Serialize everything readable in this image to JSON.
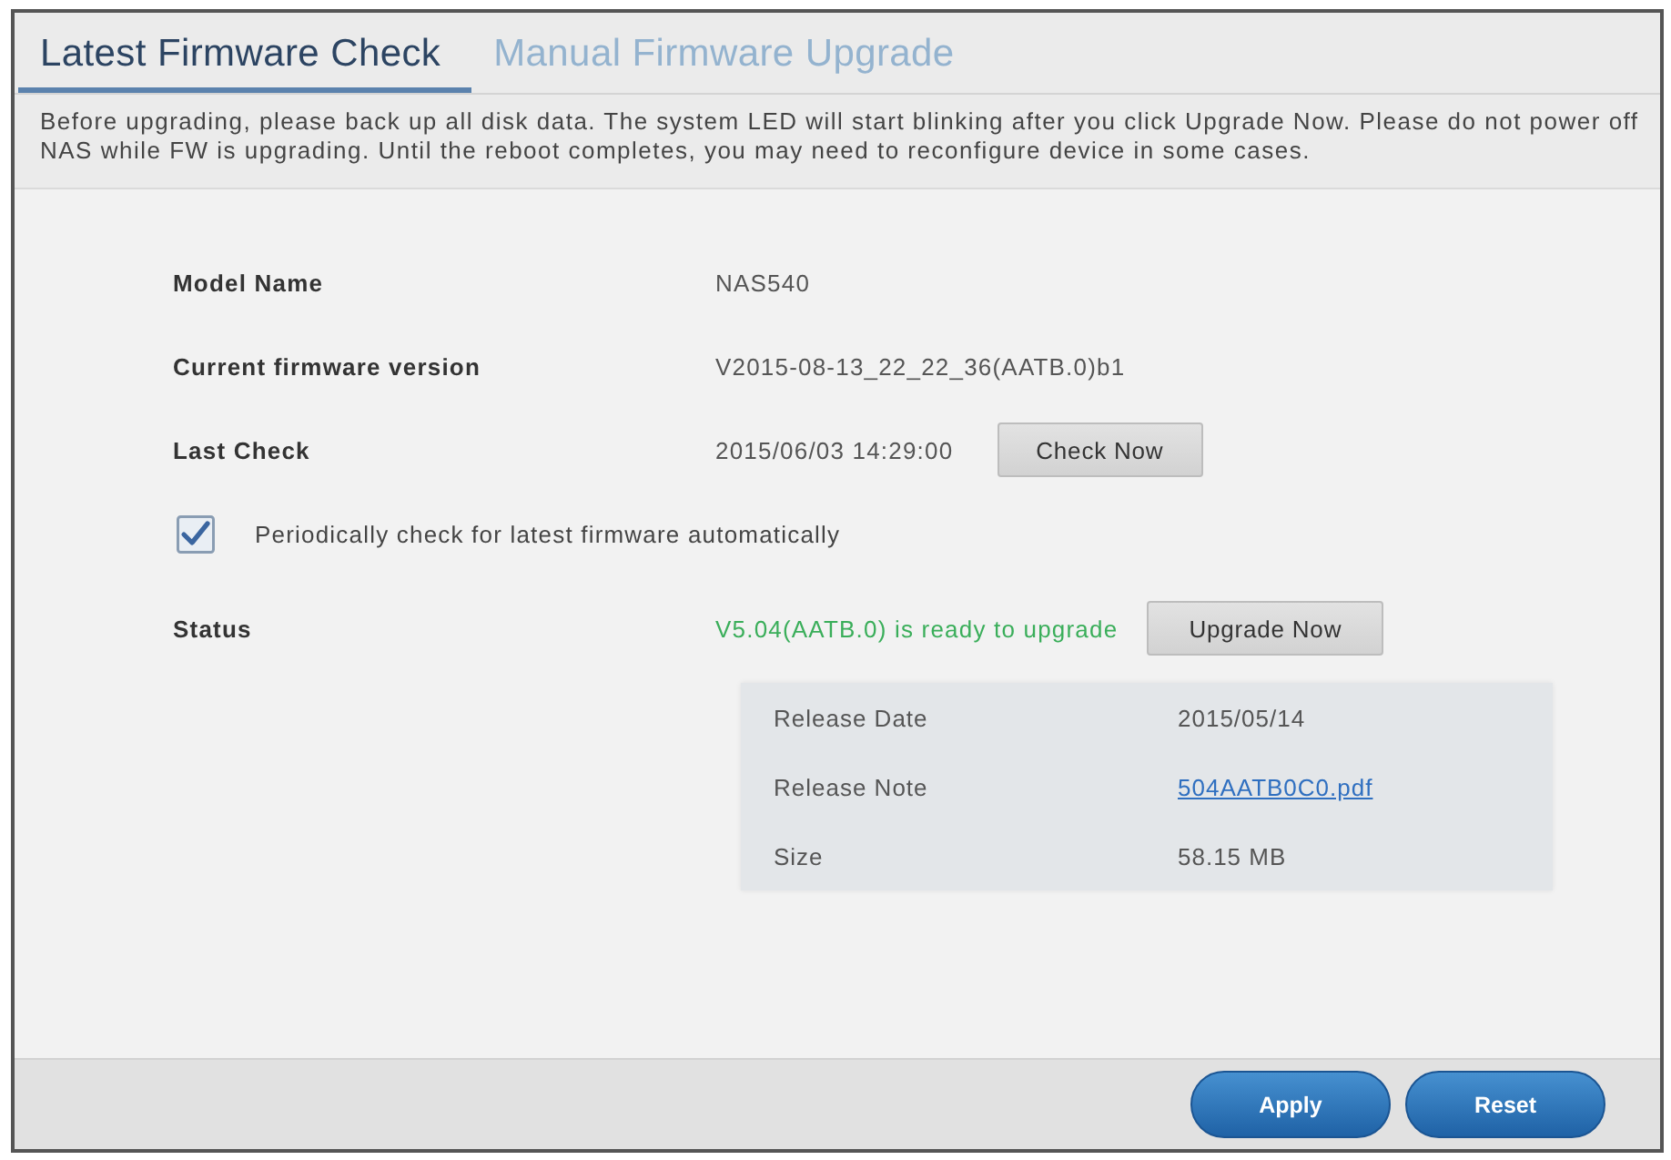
{
  "tabs": [
    {
      "label": "Latest Firmware Check",
      "selected": true
    },
    {
      "label": "Manual Firmware Upgrade",
      "selected": false
    }
  ],
  "notice": "Before upgrading, please back up all disk data. The system LED will start blinking after you click Upgrade Now. Please do not power off NAS while FW is upgrading. Until the reboot completes, you may need to reconfigure device in some cases.",
  "info_rows": [
    {
      "label": "Model Name",
      "value": "NAS540"
    },
    {
      "label": "Current firmware version",
      "value": "V2015-08-13_22_22_36(AATB.0)b1"
    },
    {
      "label": "Last Check",
      "value": "2015/06/03 14:29:00",
      "button": "Check Now"
    }
  ],
  "auto_check": {
    "label": "Periodically check for latest firmware automatically",
    "checked": true
  },
  "status": {
    "label": "Status",
    "value": "V5.04(AATB.0) is ready to upgrade",
    "button": "Upgrade Now"
  },
  "release_info": [
    {
      "label": "Release Date",
      "value": "2015/05/14",
      "kind": "text"
    },
    {
      "label": "Release Note",
      "value": "504AATB0C0.pdf",
      "kind": "link"
    },
    {
      "label": "Size",
      "value": "58.15 MB",
      "kind": "text"
    }
  ],
  "footer_buttons": [
    "Apply",
    "Reset"
  ]
}
